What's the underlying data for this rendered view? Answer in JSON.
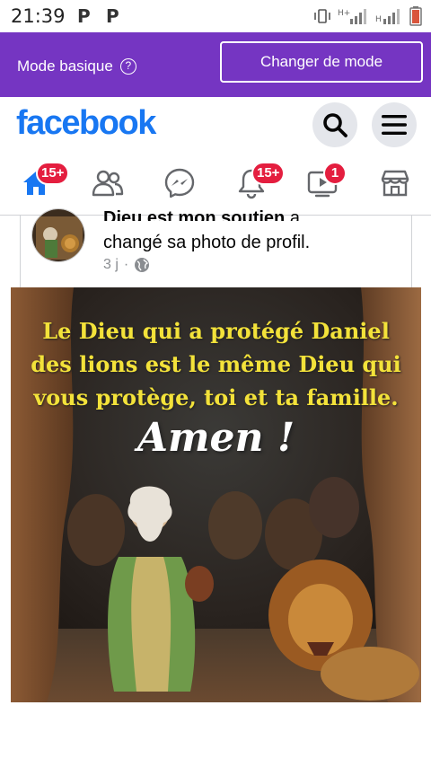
{
  "status_bar": {
    "time": "21:39",
    "app_icons": [
      "P",
      "P"
    ],
    "icons": [
      "vibrate-icon",
      "signal-h-plus-icon",
      "signal-h-icon",
      "battery-low-icon"
    ]
  },
  "mode_bar": {
    "label": "Mode basique",
    "button": "Changer de mode",
    "background": "#7535c2"
  },
  "header": {
    "logo": "facebook",
    "logo_color": "#1877f2",
    "search_icon": "search-icon",
    "menu_icon": "menu-icon"
  },
  "nav": {
    "home_badge": "15+",
    "notifications_badge": "15+",
    "video_badge": "1",
    "items": [
      "home-icon",
      "friends-icon",
      "messenger-icon",
      "notifications-icon",
      "video-icon",
      "marketplace-icon"
    ]
  },
  "post": {
    "author": "Dieu est mon soutien",
    "action_suffix": "a",
    "action": "changé sa photo de profil.",
    "time": "3 j",
    "separator": "·",
    "privacy_icon": "globe-icon",
    "image": {
      "caption_line1": "Le Dieu qui a protégé Daniel",
      "caption_line2": "des lions est le même Dieu qui",
      "caption_line3": "vous protège, toi et ta famille.",
      "amen": "Amen !"
    }
  }
}
